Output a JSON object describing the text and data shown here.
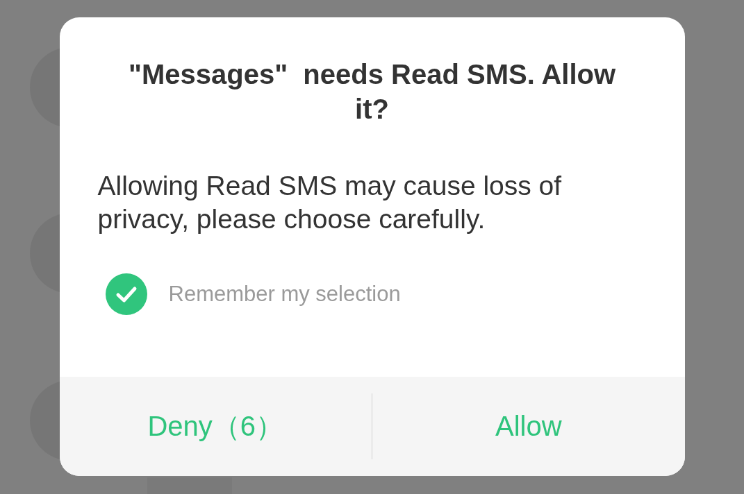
{
  "dialog": {
    "title": "\"Messages\"  needs Read SMS. Allow it?",
    "message": "Allowing Read SMS may cause loss of privacy, please choose carefully.",
    "remember": {
      "label": "Remember my selection",
      "checked": true
    },
    "buttons": [
      "Deny（6）",
      "Allow"
    ]
  }
}
